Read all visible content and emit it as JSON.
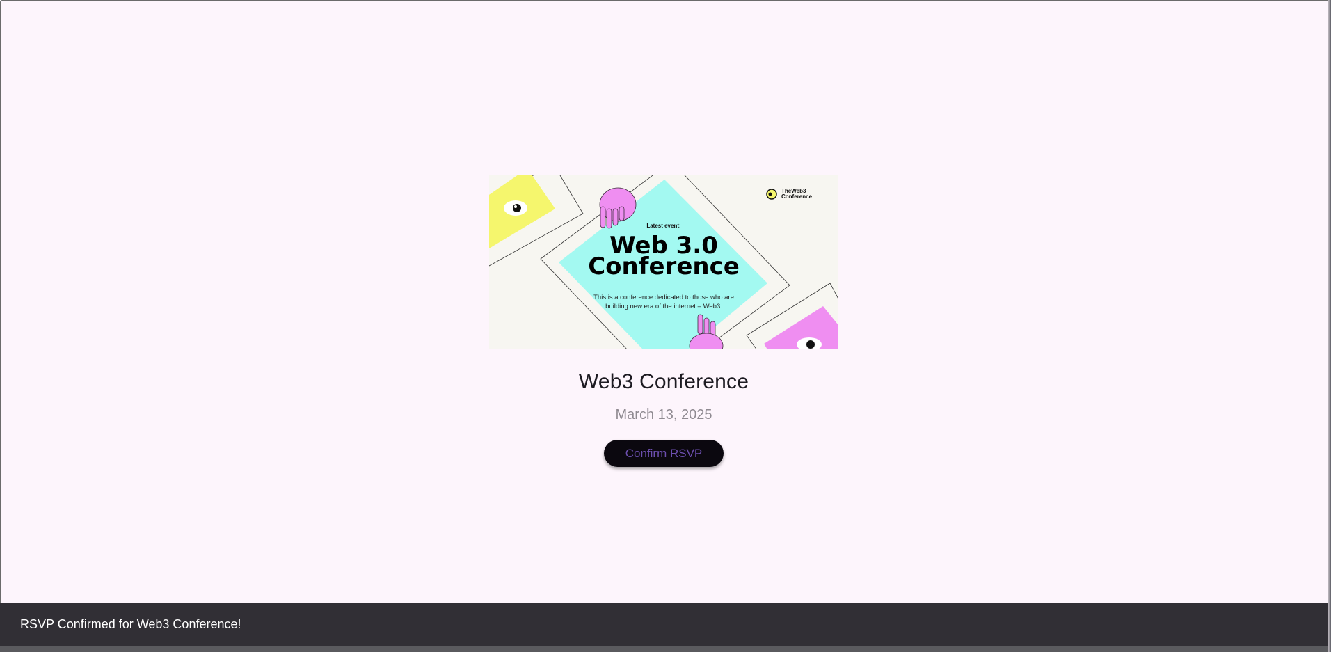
{
  "event": {
    "banner": {
      "latest_label": "Latest event:",
      "headline_line1": "Web 3.0",
      "headline_line2": "Conference",
      "description_line1": "This is a conference dedicated to those who are",
      "description_line2": "building new era of the internet – Web3.",
      "logo_line1": "TheWeb3",
      "logo_line2": "Conference",
      "colors": {
        "background": "#f7f6f1",
        "cyan": "#a3f9f1",
        "yellow": "#f5f66d",
        "pink": "#ef8ef1"
      }
    },
    "title": "Web3 Conference",
    "date": "March 13, 2025",
    "rsvp_label": "Confirm RSVP"
  },
  "snackbar": {
    "message": "RSVP Confirmed for Web3 Conference!"
  }
}
